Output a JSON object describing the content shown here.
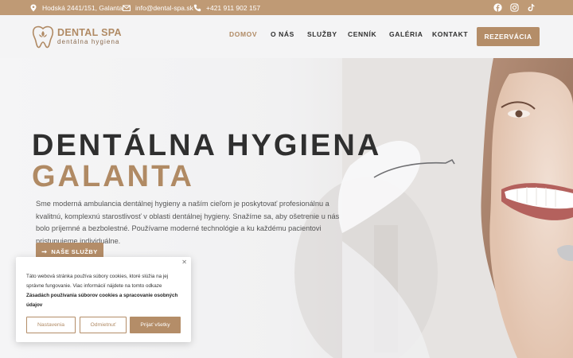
{
  "topbar": {
    "address": "Hodská 2441/151, Galanta",
    "email": "info@dental-spa.sk",
    "phone": "+421 911 902 157",
    "social": [
      "facebook-icon",
      "instagram-icon",
      "tiktok-icon"
    ]
  },
  "header": {
    "brand": "DENTAL SPA",
    "tagline": "dentálna hygiena",
    "nav": [
      {
        "label": "DOMOV",
        "active": true
      },
      {
        "label": "O NÁS",
        "active": false
      },
      {
        "label": "SLUŽBY",
        "active": false
      },
      {
        "label": "CENNÍK",
        "active": false
      },
      {
        "label": "GALÉRIA",
        "active": false
      },
      {
        "label": "KONTAKT",
        "active": false
      }
    ],
    "cta": "REZERVÁCIA"
  },
  "hero": {
    "title_line1": "DENTÁLNA HYGIENA",
    "title_line2": "GALANTA",
    "lead": "Sme moderná ambulancia dentálnej hygieny a naším cieľom je poskytovať profesionálnu a kvalitnú, komplexnú starostlivosť v oblasti dentálnej hygieny. Snažíme sa, aby ošetrenie u nás bolo príjemné a bezbolestné. Používame moderné technológie a ku každému pacientovi pristupujeme individuálne.",
    "button": "NAŠE SLUŽBY"
  },
  "cookie": {
    "text_before": "Táto webová stránka používa súbory cookies, ktoré slúžia na jej správne fungovanie. Viac informácií nájdete na tomto odkaze",
    "link": "Zásadách používania súborov cookies a spracovanie osobných údajov",
    "btn_settings": "Nastavenia",
    "btn_reject": "Odmietnuť",
    "btn_accept": "Prijať všetky"
  },
  "colors": {
    "accent": "#b48d68",
    "dark": "#2f2f2f",
    "topbar": "#bf9a75"
  }
}
